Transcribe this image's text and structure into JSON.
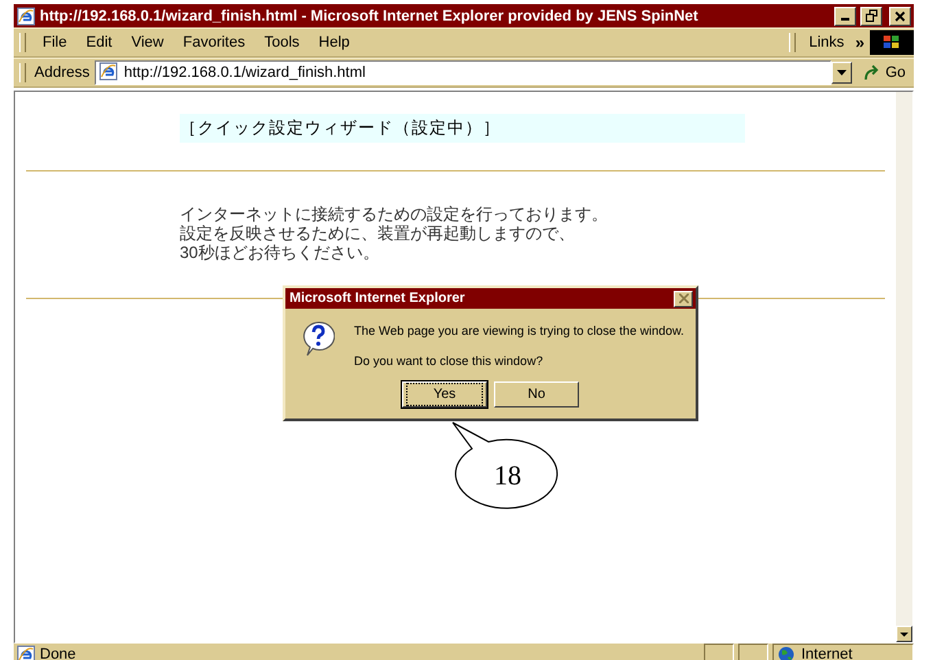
{
  "window": {
    "title": "http://192.168.0.1/wizard_finish.html - Microsoft Internet Explorer provided by JENS SpinNet"
  },
  "menu": [
    {
      "label": "File"
    },
    {
      "label": "Edit"
    },
    {
      "label": "View"
    },
    {
      "label": "Favorites"
    },
    {
      "label": "Tools"
    },
    {
      "label": "Help"
    }
  ],
  "links": {
    "label": "Links",
    "chevron": "»"
  },
  "address": {
    "label": "Address",
    "value": "http://192.168.0.1/wizard_finish.html",
    "go": "Go"
  },
  "page": {
    "heading": "［クイック設定ウィザード（設定中）］",
    "message_lines": [
      "インターネットに接続するための設定を行っております。",
      "設定を反映させるために、装置が再起動しますので、",
      "30秒ほどお待ちください。"
    ]
  },
  "dialog": {
    "title": "Microsoft Internet Explorer",
    "message": "The Web page you are viewing is trying to close the window.",
    "question": "Do you want to close this window?",
    "buttons": [
      {
        "label": "Yes",
        "default": true
      },
      {
        "label": "No",
        "default": false
      }
    ]
  },
  "status_bar": {
    "text": "Done",
    "zone": "Internet"
  },
  "callout": {
    "label": "18"
  }
}
